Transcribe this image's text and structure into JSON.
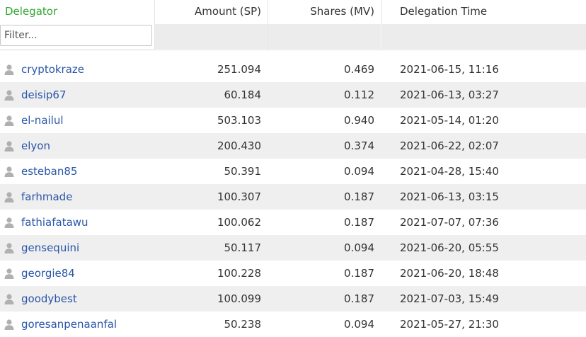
{
  "columns": {
    "delegator": "Delegator",
    "amount": "Amount (SP)",
    "shares": "Shares (MV)",
    "time": "Delegation Time"
  },
  "filter": {
    "placeholder": "Filter...",
    "value": ""
  },
  "colors": {
    "header_accent": "#2fa62f",
    "link": "#2a56a8",
    "row_alt": "#efefef",
    "icon": "#b0b0b0"
  },
  "icons": {
    "row_icon": "user-icon"
  },
  "rows": [
    {
      "name": "cryptokraze",
      "amount": "251.094",
      "shares": "0.469",
      "time": "2021-06-15, 11:16"
    },
    {
      "name": "deisip67",
      "amount": "60.184",
      "shares": "0.112",
      "time": "2021-06-13, 03:27"
    },
    {
      "name": "el-nailul",
      "amount": "503.103",
      "shares": "0.940",
      "time": "2021-05-14, 01:20"
    },
    {
      "name": "elyon",
      "amount": "200.430",
      "shares": "0.374",
      "time": "2021-06-22, 02:07"
    },
    {
      "name": "esteban85",
      "amount": "50.391",
      "shares": "0.094",
      "time": "2021-04-28, 15:40"
    },
    {
      "name": "farhmade",
      "amount": "100.307",
      "shares": "0.187",
      "time": "2021-06-13, 03:15"
    },
    {
      "name": "fathiafatawu",
      "amount": "100.062",
      "shares": "0.187",
      "time": "2021-07-07, 07:36"
    },
    {
      "name": "gensequini",
      "amount": "50.117",
      "shares": "0.094",
      "time": "2021-06-20, 05:55"
    },
    {
      "name": "georgie84",
      "amount": "100.228",
      "shares": "0.187",
      "time": "2021-06-20, 18:48"
    },
    {
      "name": "goodybest",
      "amount": "100.099",
      "shares": "0.187",
      "time": "2021-07-03, 15:49"
    },
    {
      "name": "goresanpenaanfal",
      "amount": "50.238",
      "shares": "0.094",
      "time": "2021-05-27, 21:30"
    }
  ]
}
